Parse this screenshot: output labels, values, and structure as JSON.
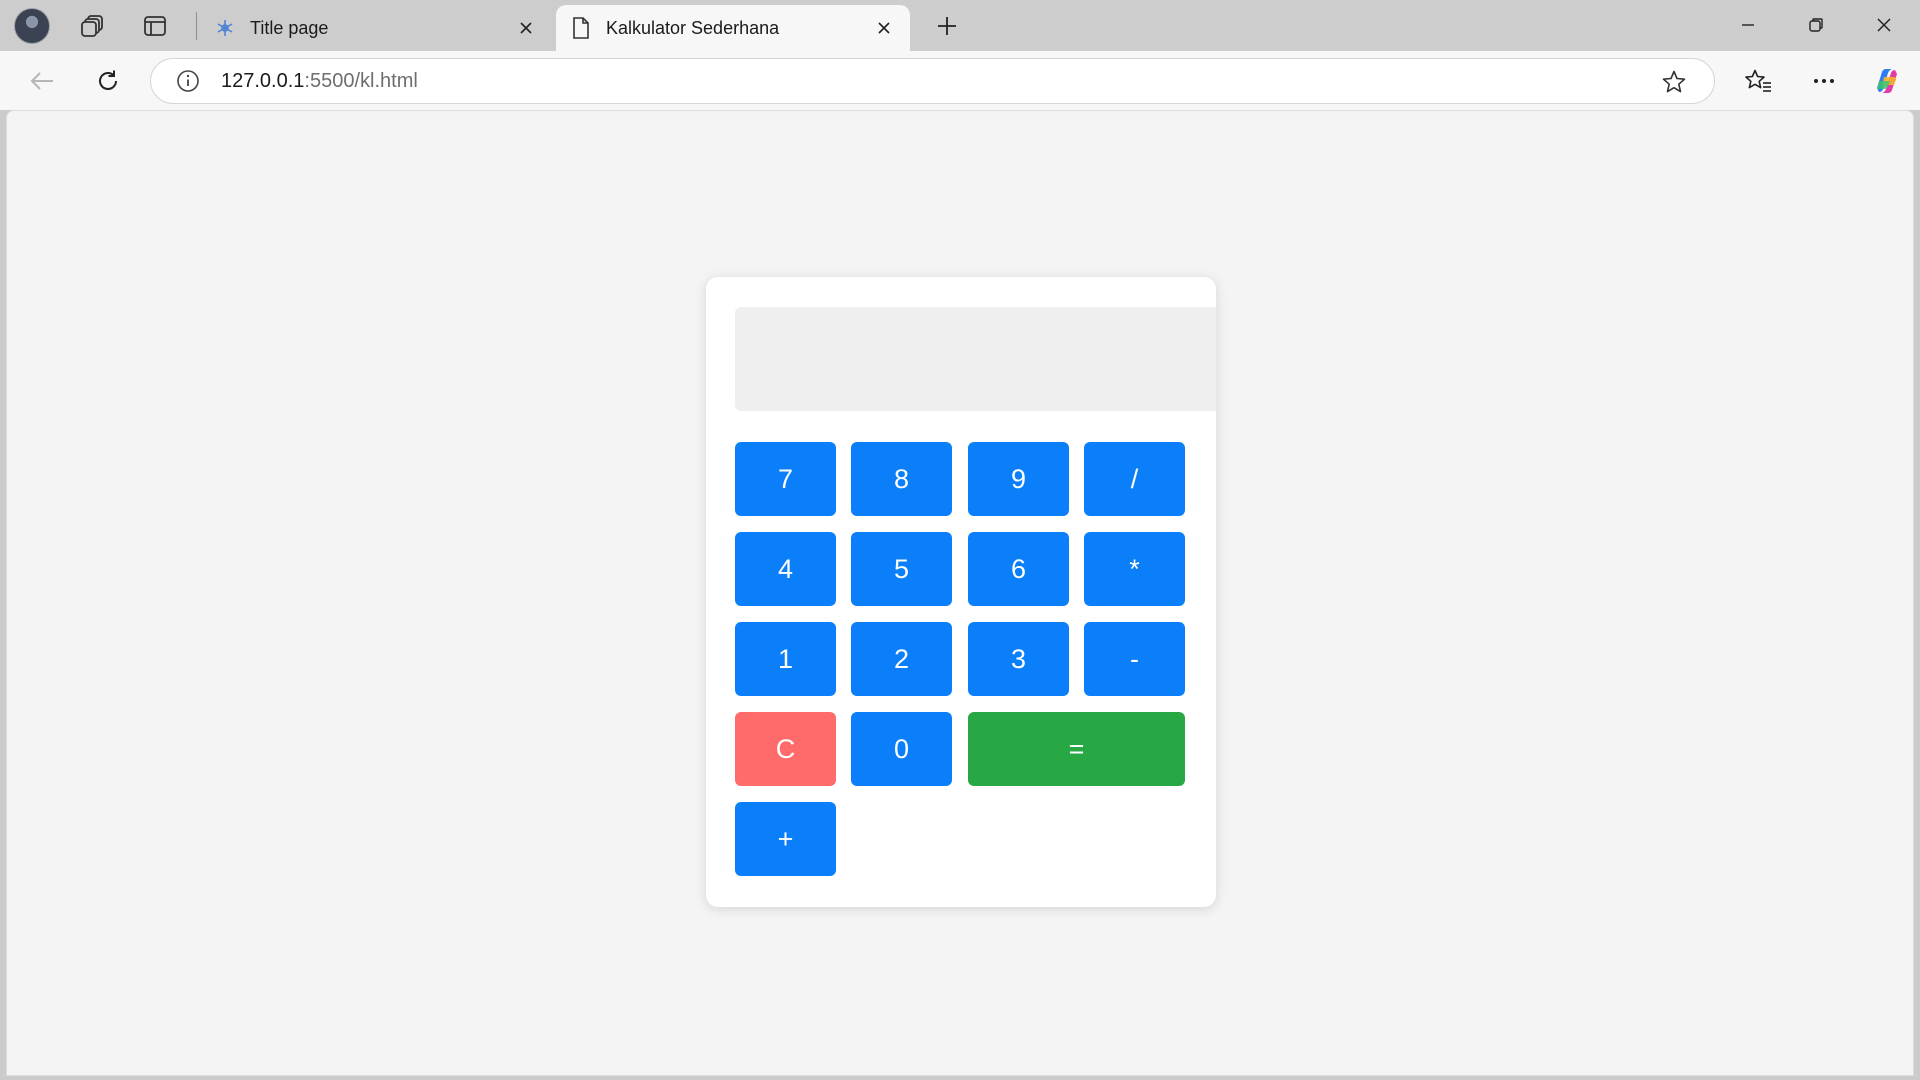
{
  "browser": {
    "tabs": [
      {
        "title": "Title page",
        "active": false
      },
      {
        "title": "Kalkulator Sederhana",
        "active": true
      }
    ],
    "address": {
      "host": "127.0.0.1",
      "path": ":5500/kl.html"
    }
  },
  "calculator": {
    "display_value": "",
    "keys": {
      "seven": "7",
      "eight": "8",
      "nine": "9",
      "divide": "/",
      "four": "4",
      "five": "5",
      "six": "6",
      "multiply": "*",
      "one": "1",
      "two": "2",
      "three": "3",
      "minus": "-",
      "clear": "C",
      "zero": "0",
      "equals": "=",
      "plus": "+"
    },
    "colors": {
      "number": "#0a7ff9",
      "clear": "#ff6b6b",
      "equals": "#28a745"
    }
  }
}
